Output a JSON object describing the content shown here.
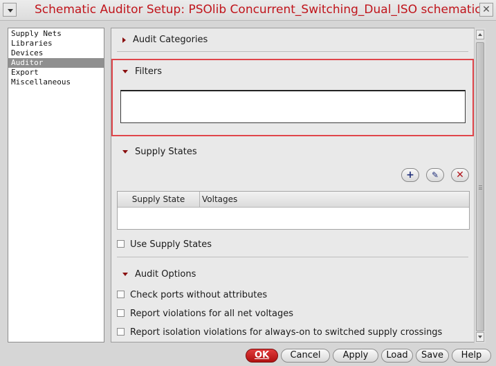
{
  "window": {
    "title": "Schematic Auditor Setup: PSOlib Concurrent_Switching_Dual_ISO schematic",
    "close_glyph": "✕"
  },
  "sidebar": {
    "items": [
      {
        "label": "Supply Nets",
        "selected": false
      },
      {
        "label": "Libraries",
        "selected": false
      },
      {
        "label": "Devices",
        "selected": false
      },
      {
        "label": "Auditor",
        "selected": true
      },
      {
        "label": "Export",
        "selected": false
      },
      {
        "label": "Miscellaneous",
        "selected": false
      }
    ]
  },
  "main": {
    "audit_categories": {
      "label": "Audit Categories",
      "expanded": false
    },
    "filters": {
      "label": "Filters",
      "expanded": true,
      "value": "",
      "highlight_color": "#e0454a"
    },
    "supply_states": {
      "label": "Supply States",
      "expanded": true,
      "toolbar": {
        "add_icon": "+",
        "edit_icon": "✎",
        "delete_icon": "✕"
      },
      "table": {
        "columns": [
          "Supply State",
          "Voltages"
        ],
        "rows": []
      },
      "use_supply_states": {
        "label": "Use Supply States",
        "checked": false
      }
    },
    "audit_options": {
      "label": "Audit Options",
      "expanded": true,
      "checks": [
        {
          "label": "Check ports without attributes",
          "checked": false
        },
        {
          "label": "Report violations for all net voltages",
          "checked": false
        },
        {
          "label": "Report isolation violations for always-on to switched supply crossings",
          "checked": false
        }
      ]
    }
  },
  "buttons": {
    "ok": {
      "label": "OK",
      "color": "#c41a1a"
    },
    "cancel": {
      "label": "Cancel"
    },
    "apply": {
      "label": "Apply"
    },
    "load": {
      "label": "Load"
    },
    "save": {
      "label": "Save"
    },
    "help": {
      "label": "Help"
    }
  }
}
